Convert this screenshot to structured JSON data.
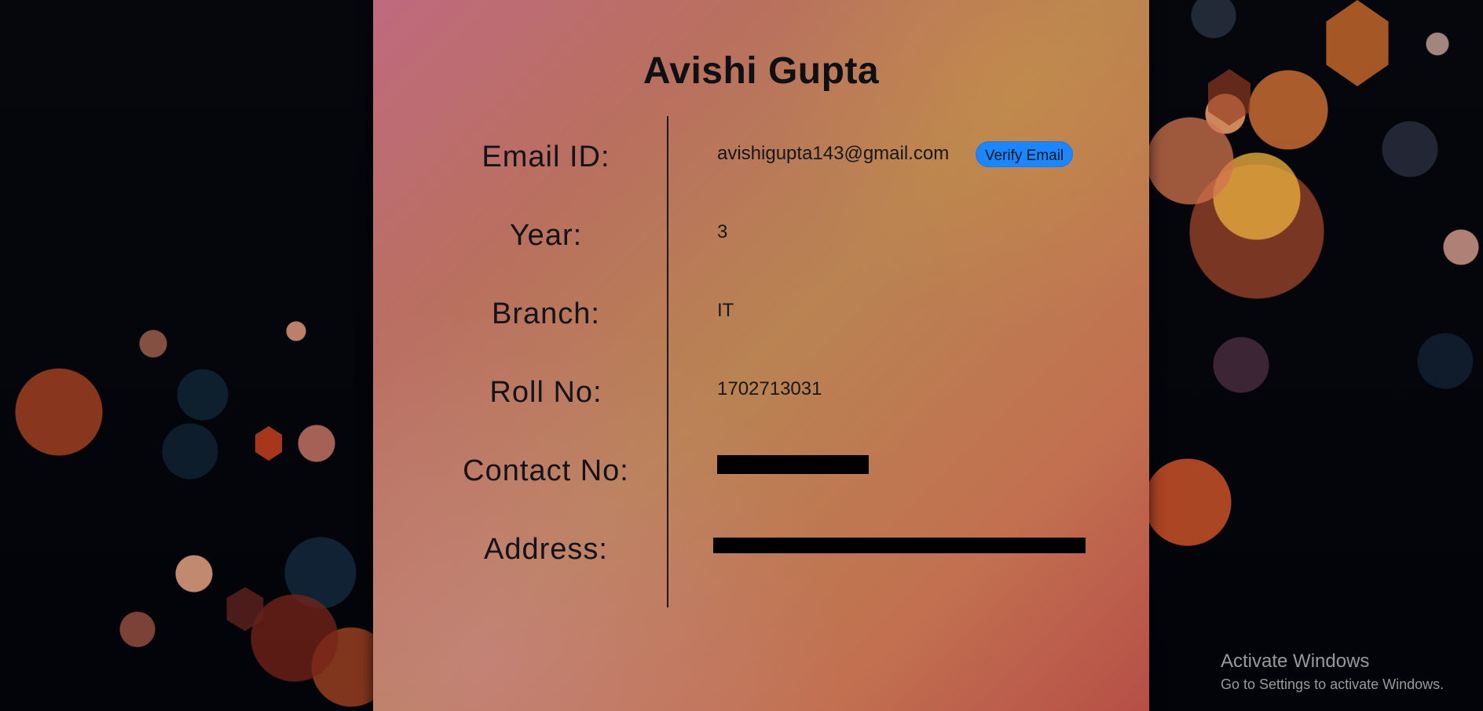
{
  "profile": {
    "name": "Avishi Gupta",
    "fields": [
      {
        "label": "Email ID:",
        "value": "avishigupta143@gmail.com"
      },
      {
        "label": "Year:",
        "value": "3"
      },
      {
        "label": "Branch:",
        "value": "IT"
      },
      {
        "label": "Roll No:",
        "value": "1702713031"
      },
      {
        "label": "Contact No:",
        "value": ""
      },
      {
        "label": "Address:",
        "value": ""
      }
    ],
    "verify_button_label": "Verify Email",
    "redacted": {
      "contact": true,
      "address": true
    }
  },
  "windows_watermark": {
    "title": "Activate Windows",
    "subtitle": "Go to Settings to activate Windows."
  },
  "colors": {
    "verify_button": "#1c86ff",
    "redaction": "#000000",
    "page_background": "#03060d"
  }
}
